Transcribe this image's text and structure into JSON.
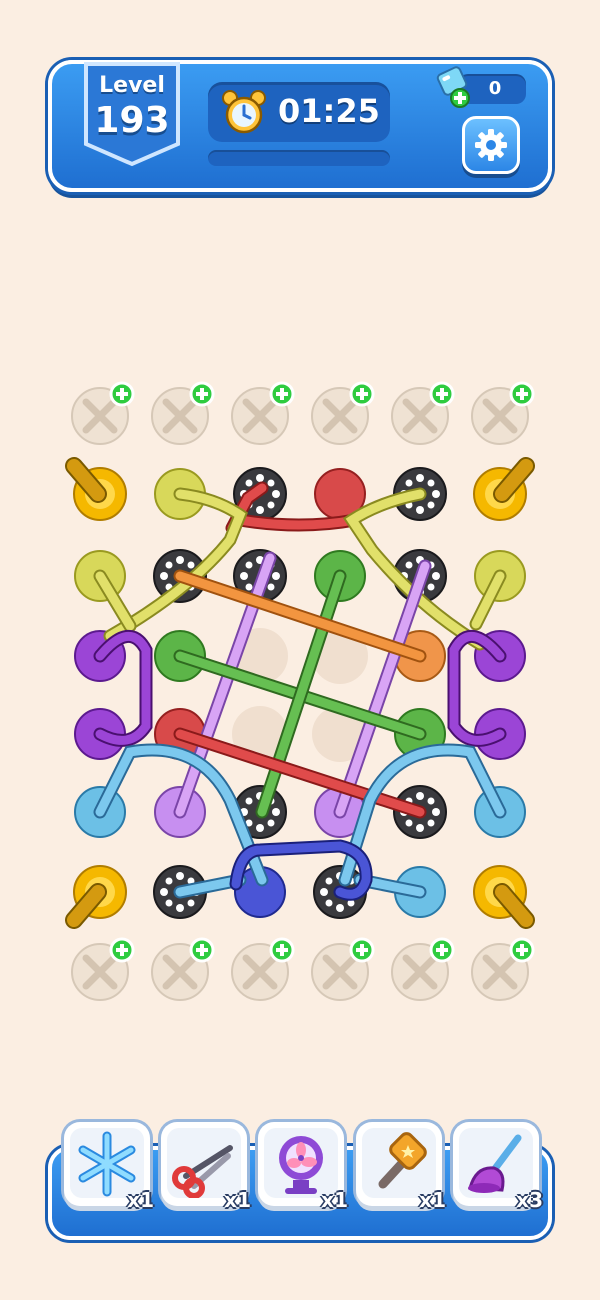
{
  "hud": {
    "level_label": "Level",
    "level_number": "193",
    "timer": "01:25",
    "timer_progress": 0.0,
    "gem_count": "0"
  },
  "boosters": [
    {
      "name": "freeze",
      "count": "x1"
    },
    {
      "name": "scissors",
      "count": "x1"
    },
    {
      "name": "fan",
      "count": "x1"
    },
    {
      "name": "hammer",
      "count": "x1"
    },
    {
      "name": "plunger",
      "count": "x3"
    }
  ],
  "colors": {
    "hud_blue": "#2a83e3",
    "background": "#fbeee2",
    "add_badge": "#2ecc40",
    "gold_pin": "#f5b800"
  }
}
